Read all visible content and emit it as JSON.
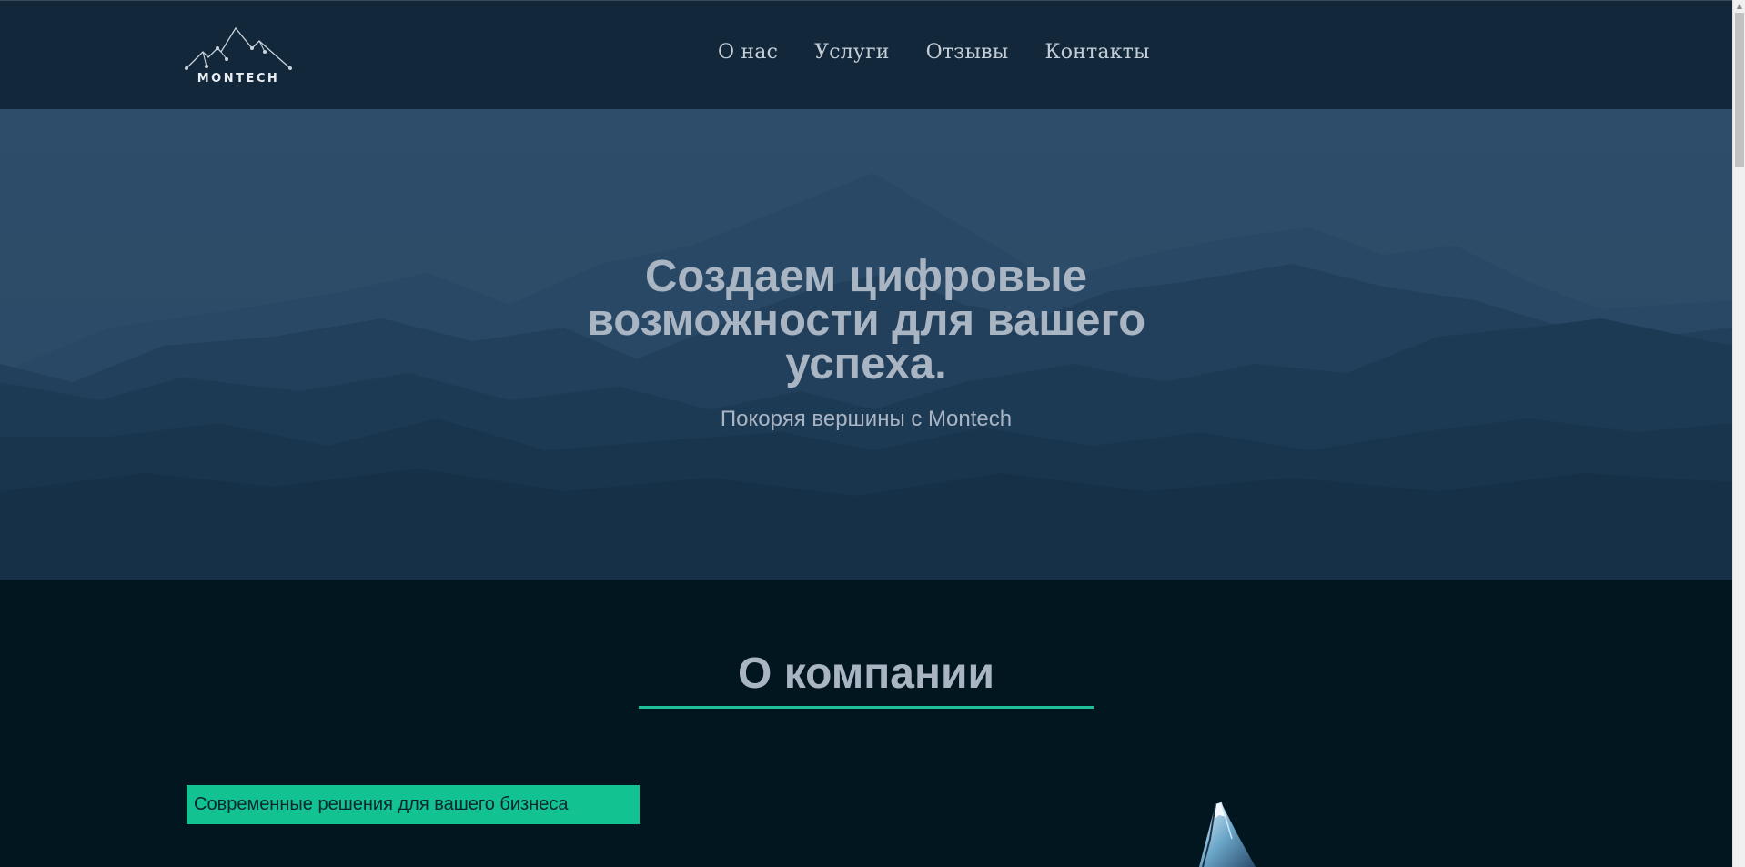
{
  "brand": {
    "logo_text": "MONTECH"
  },
  "nav": {
    "items": [
      {
        "label": "О нас"
      },
      {
        "label": "Услуги"
      },
      {
        "label": "Отзывы"
      },
      {
        "label": "Контакты"
      }
    ]
  },
  "hero": {
    "title": "Создаем цифровые возможности для вашего успеха.",
    "subtitle": "Покоряя вершины с Montech"
  },
  "about": {
    "title": "О компании",
    "badge": "Современные решения для вашего бизнеса",
    "image_icon": "mountain-peak-icon"
  },
  "colors": {
    "header_bg": "#13273a",
    "hero_bg": "#2b4a67",
    "section_bg": "#01161e",
    "accent": "#12c391",
    "text_muted": "#a9b5c2"
  }
}
